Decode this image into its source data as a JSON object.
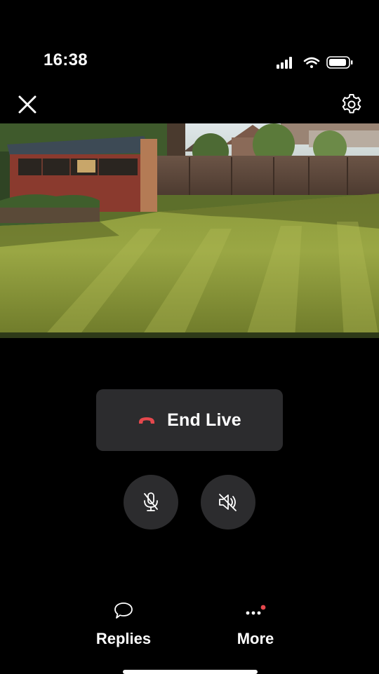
{
  "status_bar": {
    "time": "16:38",
    "icons": [
      "cellular-signal-icon",
      "wifi-icon",
      "battery-icon"
    ]
  },
  "top_bar": {
    "close_icon": "close-icon",
    "settings_icon": "gear-icon"
  },
  "live_view": {
    "feed": "live camera video feed"
  },
  "controls": {
    "end_live_label": "End Live",
    "end_live_icon": "phone-hangup-icon",
    "end_live_icon_color": "#e5484d",
    "mic_icon": "microphone-muted-icon",
    "speaker_icon": "speaker-muted-icon",
    "button_bg": "#2c2c2e"
  },
  "bottom_actions": {
    "replies": {
      "label": "Replies",
      "icon": "speech-bubble-icon"
    },
    "more": {
      "label": "More",
      "icon": "more-dots-icon",
      "badge_color": "#e5484d"
    }
  }
}
